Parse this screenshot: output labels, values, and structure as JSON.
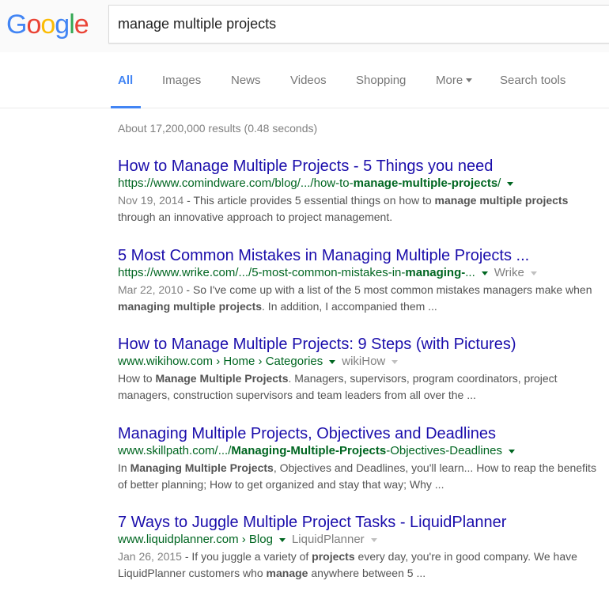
{
  "logo": {
    "letters": [
      {
        "ch": "G",
        "color": "#4285f4"
      },
      {
        "ch": "o",
        "color": "#ea4335"
      },
      {
        "ch": "o",
        "color": "#fbbc05"
      },
      {
        "ch": "g",
        "color": "#4285f4"
      },
      {
        "ch": "l",
        "color": "#34a853"
      },
      {
        "ch": "e",
        "color": "#ea4335"
      }
    ]
  },
  "search": {
    "query": "manage multiple projects"
  },
  "tabs": {
    "all": "All",
    "images": "Images",
    "news": "News",
    "videos": "Videos",
    "shopping": "Shopping",
    "more": "More",
    "tools": "Search tools"
  },
  "stats": "About 17,200,000 results (0.48 seconds)",
  "results": [
    {
      "title": "How to Manage Multiple Projects - 5 Things you need",
      "url_pre": "https://www.comindware.com/blog/.../how-to-",
      "url_bold": "manage-multiple-projects",
      "url_post": "/",
      "site": "",
      "date": "Nov 19, 2014",
      "snip1": " - This article provides 5 essential things on how to ",
      "snip1b": "manage multiple projects",
      "snip2": " through an innovative approach to project management."
    },
    {
      "title": "5 Most Common Mistakes in Managing Multiple Projects ...",
      "url_pre": "https://www.wrike.com/.../5-most-common-mistakes-in-",
      "url_bold": "managing-",
      "url_post": "...",
      "site": "Wrike",
      "date": "Mar 22, 2010",
      "snip1": " - So I've come up with a list of the 5 most common mistakes managers make when ",
      "snip1b": "managing multiple projects",
      "snip2": ". In addition, I accompanied them ..."
    },
    {
      "title": "How to Manage Multiple Projects: 9 Steps (with Pictures)",
      "url_pre": "www.wikihow.com › Home › Categories",
      "url_bold": "",
      "url_post": "",
      "site": "wikiHow",
      "date": "",
      "snip1": "How to ",
      "snip1b": "Manage Multiple Projects",
      "snip2": ". Managers, supervisors, program coordinators, project managers, construction supervisors and team leaders from all over the ..."
    },
    {
      "title": "Managing Multiple Projects, Objectives and Deadlines",
      "url_pre": "www.skillpath.com/.../",
      "url_bold": "Managing-Multiple-Projects",
      "url_post": "-Objectives-Deadlines",
      "site": "",
      "date": "",
      "snip1": "In ",
      "snip1b": "Managing Multiple Projects",
      "snip2": ", Objectives and Deadlines, you'll learn... How to reap the benefits of better planning; How to get organized and stay that way; Why ..."
    },
    {
      "title": "7 Ways to Juggle Multiple Project Tasks - LiquidPlanner",
      "url_pre": "www.liquidplanner.com › Blog",
      "url_bold": "",
      "url_post": "",
      "site": "LiquidPlanner",
      "date": "Jan 26, 2015",
      "snip1": " - If you juggle a variety of ",
      "snip1b": "projects",
      "snip2": " every day, you're in good company. We have LiquidPlanner customers who ",
      "snip2b": "manage",
      "snip3": " anywhere between 5  ..."
    }
  ]
}
